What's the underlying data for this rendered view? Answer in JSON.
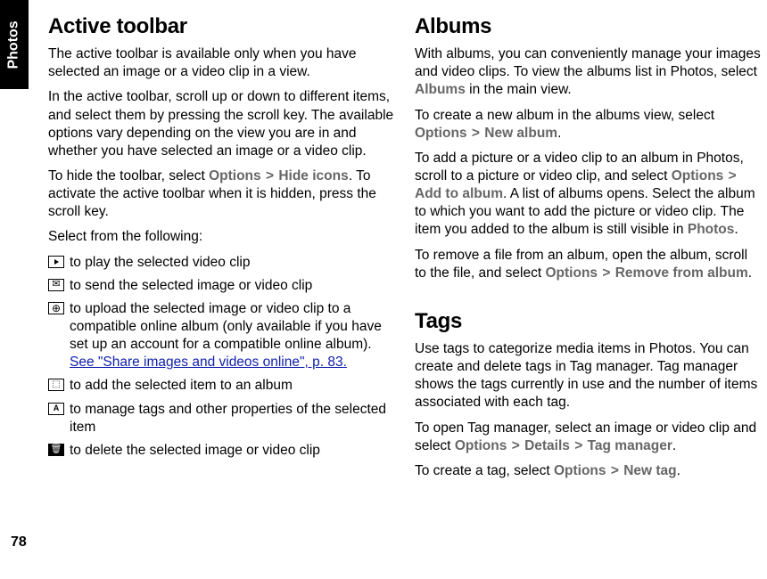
{
  "sideTab": "Photos",
  "pageNumber": "78",
  "left": {
    "heading1": "Active toolbar",
    "p1": "The active toolbar is available only when you have selected an image or a video clip in a view.",
    "p2": "In the active toolbar, scroll up or down to different items, and select them by pressing the scroll key. The available options vary depending on the view you are in and whether you have selected an image or a video clip.",
    "p3a": "To hide the toolbar, select ",
    "p3_opt": "Options",
    "p3_gt": ">",
    "p3_hide": "Hide icons",
    "p3b": ". To activate the active toolbar when it is hidden, press the scroll key.",
    "p4": "Select from the following:",
    "item_play": " to play the selected video clip",
    "item_send": " to send the selected image or video clip",
    "item_upload_a": " to upload the selected image or video clip to a compatible online album (only available if you have set up an account for a compatible online album). ",
    "item_upload_link": "See \"Share images and videos online\", p. 83.",
    "item_album": " to add the selected item to an album",
    "item_tag": " to manage tags and other properties of the selected item",
    "item_delete": " to delete the selected image or video clip"
  },
  "right": {
    "heading1": "Albums",
    "a_p1a": "With albums, you can conveniently manage your images and video clips. To view the albums list in Photos, select ",
    "a_p1_albums": "Albums",
    "a_p1b": " in the main view.",
    "a_p2a": "To create a new album in the albums view, select ",
    "a_p2_opt": "Options",
    "a_gt": ">",
    "a_p2_new": "New album",
    "a_p2b": ".",
    "a_p3a": "To add a picture or a video clip to an album in Photos, scroll to a picture or video clip, and select ",
    "a_p3_opt": "Options",
    "a_p3_add": "Add to album",
    "a_p3b": ". A list of albums opens. Select the album to which you want to add the picture or video clip. The item you added to the album is still visible in ",
    "a_p3_photos": "Photos",
    "a_p3c": ".",
    "a_p4a": "To remove a file from an album, open the album, scroll to the file, and select ",
    "a_p4_opt": "Options",
    "a_p4_remove": "Remove from album",
    "a_p4b": ".",
    "heading2": "Tags",
    "t_p1": "Use tags to categorize media items in Photos. You can create and delete tags in Tag manager. Tag manager shows the tags currently in use and the number of items associated with each tag.",
    "t_p2a": "To open Tag manager, select an image or video clip and select ",
    "t_p2_opt": "Options",
    "t_p2_details": "Details",
    "t_p2_tagmgr": "Tag manager",
    "t_p2b": ".",
    "t_p3a": "To create a tag, select ",
    "t_p3_opt": "Options",
    "t_p3_new": "New tag",
    "t_p3b": "."
  }
}
